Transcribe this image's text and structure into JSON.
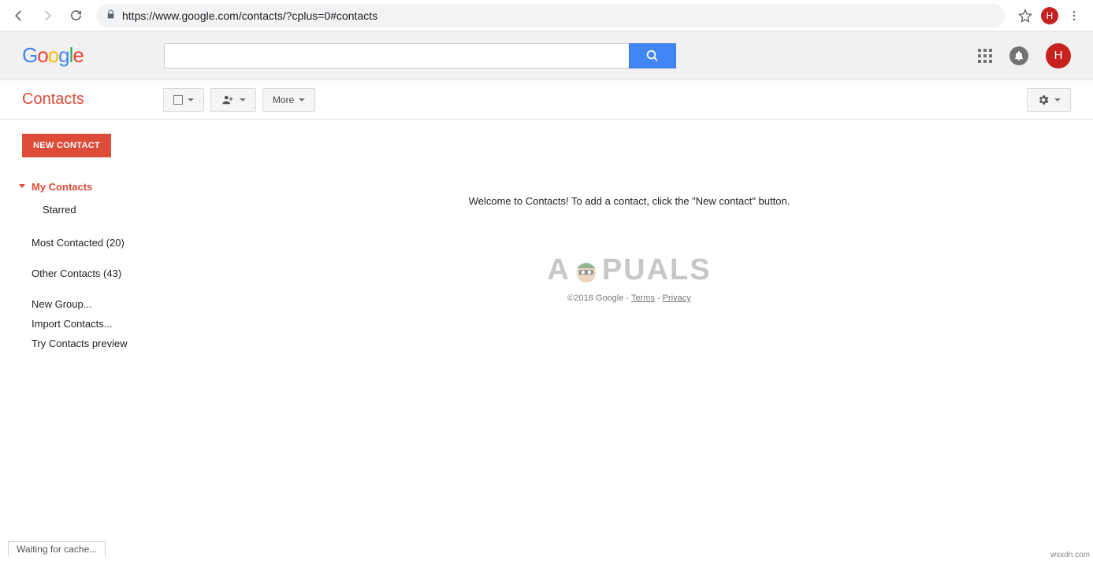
{
  "browser": {
    "url": "https://www.google.com/contacts/?cplus=0#contacts",
    "profile_letter": "H",
    "status_text": "Waiting for cache..."
  },
  "header": {
    "logo_letters": [
      "G",
      "o",
      "o",
      "g",
      "l",
      "e"
    ],
    "search_value": "",
    "avatar_letter": "H"
  },
  "toolbar": {
    "title": "Contacts",
    "more_label": "More"
  },
  "sidebar": {
    "new_contact_label": "NEW CONTACT",
    "my_contacts": "My Contacts",
    "starred": "Starred",
    "most_contacted": "Most Contacted (20)",
    "other_contacts": "Other Contacts (43)",
    "new_group": "New Group...",
    "import_contacts": "Import Contacts...",
    "try_preview": "Try Contacts preview"
  },
  "main": {
    "welcome": "Welcome to Contacts! To add a contact, click the \"New contact\" button.",
    "copyright": "©2018 Google",
    "terms": "Terms",
    "privacy": "Privacy",
    "separator": " - "
  },
  "watermark_text": "A  PUALS",
  "site_tag": "wsxdn.com"
}
